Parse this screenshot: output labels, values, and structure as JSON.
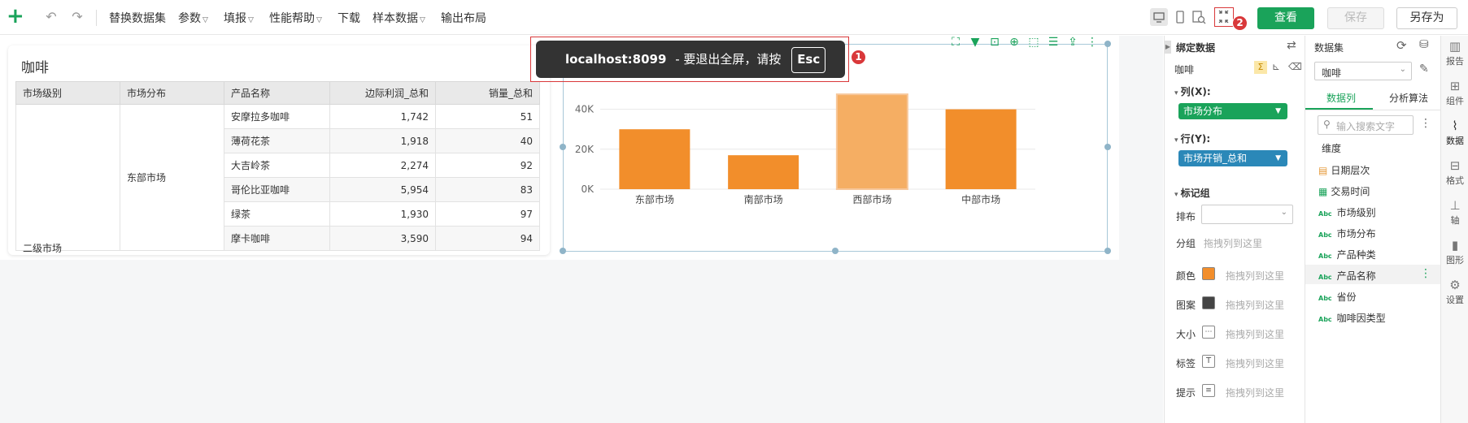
{
  "toolbar": {
    "add_icon": "plus-icon",
    "menus": [
      {
        "label": "替换数据集",
        "has_caret": false
      },
      {
        "label": "参数",
        "has_caret": true
      },
      {
        "label": "填报",
        "has_caret": true
      },
      {
        "label": "性能帮助",
        "has_caret": true
      },
      {
        "label": "下载",
        "has_caret": false
      },
      {
        "label": "样本数据",
        "has_caret": true
      },
      {
        "label": "输出布局",
        "has_caret": false
      }
    ],
    "view_button": "查看",
    "save_button": "保存",
    "save_as_button": "另存为"
  },
  "fullscreen_banner": {
    "host": "localhost:8099",
    "message": "- 要退出全屏，请按",
    "key": "Esc",
    "badge1": "1",
    "badge2": "2"
  },
  "table_card": {
    "title": "咖啡",
    "headers": [
      "市场级别",
      "市场分布",
      "产品名称",
      "边际利润_总和",
      "销量_总和"
    ],
    "level": "二级市场",
    "region": "东部市场",
    "rows": [
      {
        "product": "安摩拉多咖啡",
        "profit": "1,742",
        "sales": "51"
      },
      {
        "product": "薄荷花茶",
        "profit": "1,918",
        "sales": "40"
      },
      {
        "product": "大吉岭茶",
        "profit": "2,274",
        "sales": "92"
      },
      {
        "product": "哥伦比亚咖啡",
        "profit": "5,954",
        "sales": "83"
      },
      {
        "product": "绿茶",
        "profit": "1,930",
        "sales": "97"
      },
      {
        "product": "摩卡咖啡",
        "profit": "3,590",
        "sales": "94"
      }
    ]
  },
  "chart_data": {
    "type": "bar",
    "categories": [
      "东部市场",
      "南部市场",
      "西部市场",
      "中部市场"
    ],
    "values": [
      30000,
      17000,
      47500,
      40000
    ],
    "y_ticks": [
      "0K",
      "20K",
      "40K"
    ],
    "ylim": [
      0,
      50000
    ],
    "color": "#f28e2b",
    "highlight_color": "#f5ae63",
    "highlight_index": 2
  },
  "bind_panel": {
    "title": "绑定数据",
    "dataset": "咖啡",
    "col_label": "列(X):",
    "col_field": "市场分布",
    "row_label": "行(Y):",
    "row_field": "市场开销_总和",
    "marks_label": "标记组",
    "sort_label": "排布",
    "group_label": "分组",
    "group_placeholder": "拖拽列到这里",
    "props": [
      {
        "label": "颜色",
        "placeholder": "拖拽列到这里",
        "swatch": "#f28e2b"
      },
      {
        "label": "图案",
        "placeholder": "拖拽列到这里",
        "swatch": "#444444"
      },
      {
        "label": "大小",
        "placeholder": "拖拽列到这里",
        "swatch": ""
      },
      {
        "label": "标签",
        "placeholder": "拖拽列到这里",
        "swatch": ""
      },
      {
        "label": "提示",
        "placeholder": "拖拽列到这里",
        "swatch": ""
      }
    ],
    "col_color": "#1aa35a",
    "row_color": "#2b88b8"
  },
  "dataset_panel": {
    "title": "数据集",
    "selected": "咖啡",
    "tab_columns": "数据列",
    "tab_algo": "分析算法",
    "search_placeholder": "输入搜索文字",
    "dimension_label": "维度",
    "fields": [
      {
        "name": "日期层次",
        "type": "hierarchy"
      },
      {
        "name": "交易时间",
        "type": "date"
      },
      {
        "name": "市场级别",
        "type": "text"
      },
      {
        "name": "市场分布",
        "type": "text"
      },
      {
        "name": "产品种类",
        "type": "text"
      },
      {
        "name": "产品名称",
        "type": "text"
      },
      {
        "name": "省份",
        "type": "text"
      },
      {
        "name": "咖啡因类型",
        "type": "text"
      }
    ],
    "abc_label": "Abc"
  },
  "side_strip": {
    "items": [
      {
        "label": "报告",
        "icon": "report-icon"
      },
      {
        "label": "组件",
        "icon": "component-icon"
      },
      {
        "label": "数据",
        "icon": "data-icon"
      },
      {
        "label": "格式",
        "icon": "format-icon"
      },
      {
        "label": "轴",
        "icon": "axis-icon"
      },
      {
        "label": "图形",
        "icon": "graph-icon"
      },
      {
        "label": "设置",
        "icon": "settings-icon"
      }
    ]
  }
}
